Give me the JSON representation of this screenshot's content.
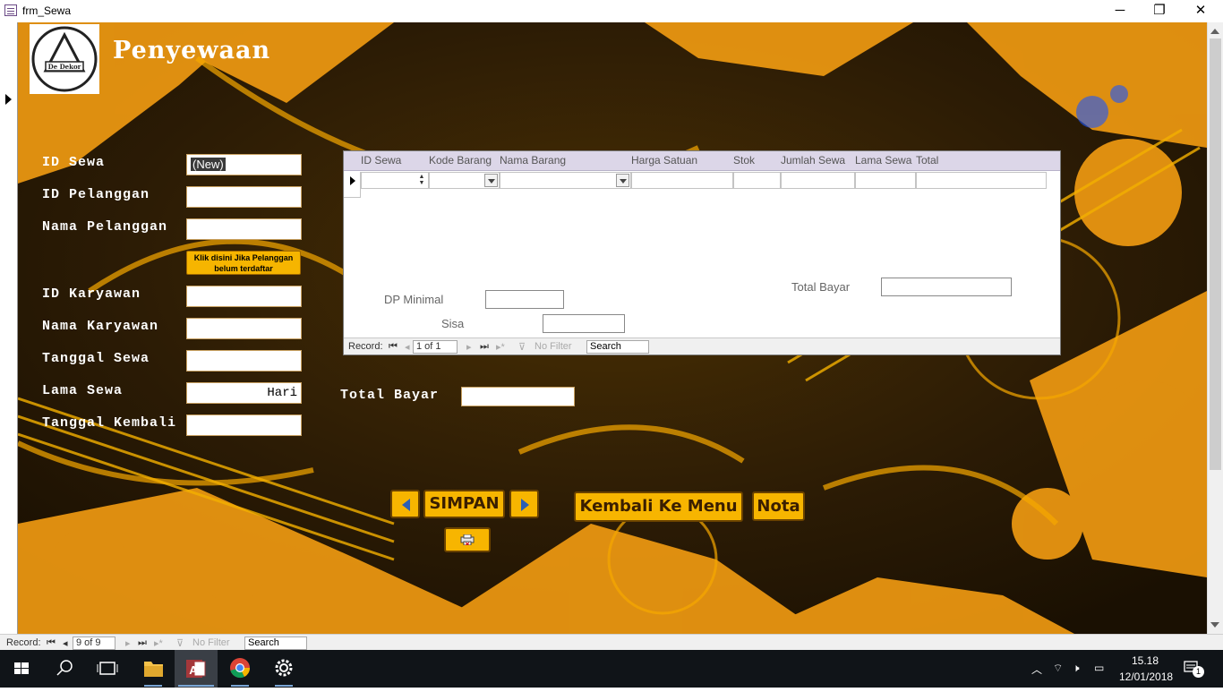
{
  "window": {
    "title": "frm_Sewa",
    "min": "─",
    "restore": "❐",
    "close": "✕"
  },
  "form": {
    "heading": "Penyewaan",
    "logo_text": "De Dekor",
    "fields": [
      {
        "label": "ID Sewa",
        "value": "(New)"
      },
      {
        "label": "ID Pelanggan",
        "value": ""
      },
      {
        "label": "Nama Pelanggan",
        "value": ""
      },
      {
        "label": "ID Karyawan",
        "value": ""
      },
      {
        "label": "Nama Karyawan",
        "value": ""
      },
      {
        "label": "Tanggal Sewa",
        "value": ""
      },
      {
        "label": "Lama Sewa",
        "value": "Hari"
      },
      {
        "label": "Tanggal Kembali",
        "value": ""
      }
    ],
    "register_button": "Klik disini Jika Pelanggan belum terdaftar",
    "total_bayar_label": "Total Bayar",
    "buttons": {
      "prev": "◀",
      "save": "SIMPAN",
      "next": "▶",
      "back": "Kembali Ke Menu",
      "nota": "Nota",
      "print_icon": "printer-icon"
    }
  },
  "subform": {
    "columns": [
      "ID Sewa",
      "Kode Barang",
      "Nama Barang",
      "Harga Satuan",
      "Stok",
      "Jumlah Sewa",
      "Lama Sewa",
      "Total"
    ],
    "total_bayar_label": "Total Bayar",
    "dp_label": "DP Minimal",
    "sisa_label": "Sisa",
    "nav": {
      "record_label": "Record:",
      "position": "1 of 1",
      "filter": "No Filter",
      "search": "Search"
    }
  },
  "main_nav": {
    "record_label": "Record:",
    "position": "9 of 9",
    "filter": "No Filter",
    "search": "Search"
  },
  "taskbar": {
    "time": "15.18",
    "date": "12/01/2018",
    "notifications": "1"
  },
  "colors": {
    "accent": "#f7b500",
    "dark": "#2b1b05",
    "taskbar": "#101418"
  }
}
